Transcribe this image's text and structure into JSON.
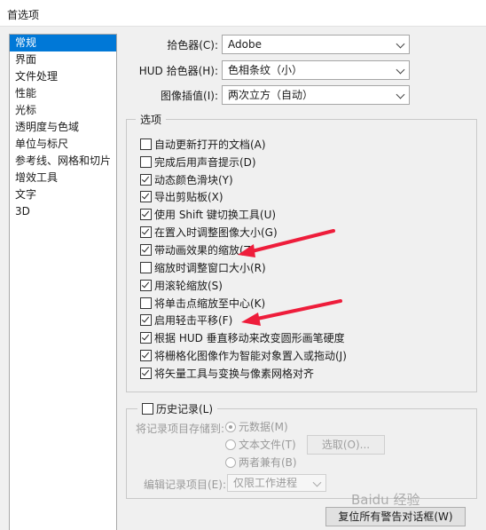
{
  "window": {
    "title": "首选项"
  },
  "sidebar": {
    "items": [
      {
        "label": "常规",
        "selected": true
      },
      {
        "label": "界面"
      },
      {
        "label": "文件处理"
      },
      {
        "label": "性能"
      },
      {
        "label": "光标"
      },
      {
        "label": "透明度与色域"
      },
      {
        "label": "单位与标尺"
      },
      {
        "label": "参考线、网格和切片"
      },
      {
        "label": "增效工具"
      },
      {
        "label": "文字"
      },
      {
        "label": "3D"
      }
    ]
  },
  "pickers": {
    "color_picker": {
      "label": "拾色器(C):",
      "value": "Adobe"
    },
    "hud_picker": {
      "label": "HUD 拾色器(H):",
      "value": "色相条纹（小）"
    },
    "interpolation": {
      "label": "图像插值(I):",
      "value": "两次立方（自动）"
    }
  },
  "options": {
    "legend": "选项",
    "items": [
      {
        "label": "自动更新打开的文档(A)",
        "checked": false
      },
      {
        "label": "完成后用声音提示(D)",
        "checked": false
      },
      {
        "label": "动态颜色滑块(Y)",
        "checked": true
      },
      {
        "label": "导出剪贴板(X)",
        "checked": true
      },
      {
        "label": "使用 Shift 键切换工具(U)",
        "checked": true
      },
      {
        "label": "在置入时调整图像大小(G)",
        "checked": true
      },
      {
        "label": "带动画效果的缩放(Z)",
        "checked": true
      },
      {
        "label": "缩放时调整窗口大小(R)",
        "checked": false
      },
      {
        "label": "用滚轮缩放(S)",
        "checked": true
      },
      {
        "label": "将单击点缩放至中心(K)",
        "checked": false
      },
      {
        "label": "启用轻击平移(F)",
        "checked": true
      },
      {
        "label": "根据 HUD 垂直移动来改变圆形画笔硬度",
        "checked": true
      },
      {
        "label": "将栅格化图像作为智能对象置入或拖动(J)",
        "checked": true
      },
      {
        "label": "将矢量工具与变换与像素网格对齐",
        "checked": true
      }
    ]
  },
  "history": {
    "legend": "历史记录(L)",
    "checked": false,
    "save_to_label": "将记录项目存储到:",
    "radios": [
      {
        "label": "元数据(M)",
        "selected": true
      },
      {
        "label": "文本文件(T)",
        "selected": false
      },
      {
        "label": "两者兼有(B)",
        "selected": false
      }
    ],
    "choose_button": "选取(O)...",
    "edit_log_label": "编辑记录项目(E):",
    "edit_log_value": "仅限工作进程"
  },
  "footer": {
    "reset_warnings_button": "复位所有警告对话框(W)"
  },
  "watermark": "Baidu 经验",
  "colors": {
    "selection": "#0078d7",
    "annotation_arrow": "#ee1d3b"
  }
}
